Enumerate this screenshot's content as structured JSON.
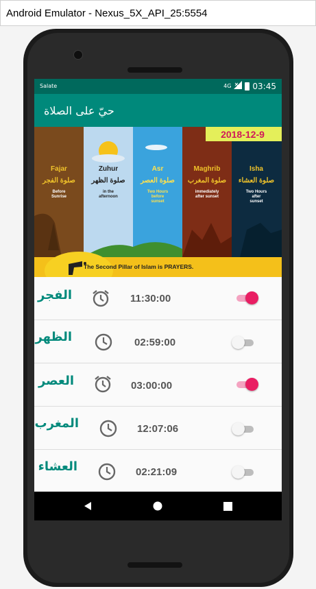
{
  "window": {
    "title": "Android Emulator - Nexus_5X_API_25:5554"
  },
  "status_bar": {
    "app_label": "Salate",
    "network": "4G",
    "time": "03:45"
  },
  "app_bar": {
    "title": "حيّ على الصلاة"
  },
  "banner": {
    "date": "2018-12-9",
    "caption": "The Second Pillar of Islam is PRAYERS.",
    "columns": [
      {
        "name": "Fajar",
        "arabic": "صلوة الفجر",
        "note1": "Before",
        "note2": "Sunrise"
      },
      {
        "name": "Zuhur",
        "arabic": "صلوة الظهر",
        "note1": "in the",
        "note2": "afternoon"
      },
      {
        "name": "Asr",
        "arabic": "صلوة العصر",
        "note1": "Two Hours",
        "note2": "before",
        "note3": "sunset"
      },
      {
        "name": "Maghrib",
        "arabic": "صلوة المغرب",
        "note1": "immediately",
        "note2": "after sunset"
      },
      {
        "name": "Isha",
        "arabic": "صلوة العشاء",
        "note1": "Two Hours",
        "note2": "after",
        "note3": "sunset"
      }
    ]
  },
  "prayers": [
    {
      "name": "الفجر",
      "time": "11:30:00",
      "enabled": true
    },
    {
      "name": "الظهر",
      "time": "02:59:00",
      "enabled": false
    },
    {
      "name": "العصر",
      "time": "03:00:00",
      "enabled": true
    },
    {
      "name": "المغرب",
      "time": "12:07:06",
      "enabled": false
    },
    {
      "name": "العشاء",
      "time": "02:21:09",
      "enabled": false
    }
  ],
  "colors": {
    "primary": "#00897b",
    "primary_dark": "#00695c",
    "accent": "#e91e63"
  },
  "icons": [
    "alarm-clock-icon",
    "clock-icon",
    "back-icon",
    "home-icon",
    "recents-icon",
    "battery-icon",
    "signal-icon"
  ]
}
